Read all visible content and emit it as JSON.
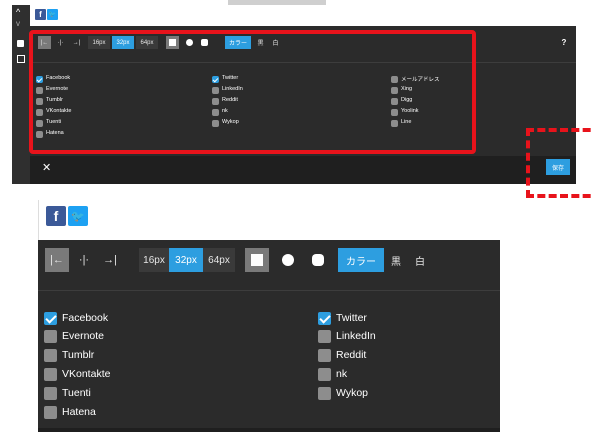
{
  "top": {
    "share_icons": [
      "f",
      "🐦"
    ],
    "toolbar": {
      "align_left": "|←",
      "align_center": "·|·",
      "align_right": "→|",
      "size_16": "16px",
      "size_32": "32px",
      "size_64": "64px",
      "color_label": "カラー",
      "black_label": "黒",
      "white_label": "白",
      "help": "?"
    },
    "networks": [
      {
        "label": "Facebook",
        "checked": true
      },
      {
        "label": "Evernote",
        "checked": false
      },
      {
        "label": "Tumblr",
        "checked": false
      },
      {
        "label": "VKontakte",
        "checked": false
      },
      {
        "label": "Tuenti",
        "checked": false
      },
      {
        "label": "Hatena",
        "checked": false
      },
      {
        "label": "Twitter",
        "checked": true
      },
      {
        "label": "LinkedIn",
        "checked": false
      },
      {
        "label": "Reddit",
        "checked": false
      },
      {
        "label": "nk",
        "checked": false
      },
      {
        "label": "Wykop",
        "checked": false
      },
      {
        "label": "メールアドレス",
        "checked": false
      },
      {
        "label": "Xing",
        "checked": false
      },
      {
        "label": "Digg",
        "checked": false
      },
      {
        "label": "Yoolink",
        "checked": false
      },
      {
        "label": "Line",
        "checked": false
      }
    ],
    "close_label": "✕",
    "save_label": "保存"
  },
  "zoom": {
    "share_icons": [
      "f",
      "🐦"
    ],
    "toolbar": {
      "align_left": "|←",
      "align_center": "·|·",
      "align_right": "→|",
      "size_16": "16px",
      "size_32": "32px",
      "size_64": "64px",
      "color_label": "カラー",
      "black_label": "黒",
      "white_label": "白"
    },
    "networks": [
      {
        "label": "Facebook",
        "checked": true
      },
      {
        "label": "Evernote",
        "checked": false
      },
      {
        "label": "Tumblr",
        "checked": false
      },
      {
        "label": "VKontakte",
        "checked": false
      },
      {
        "label": "Tuenti",
        "checked": false
      },
      {
        "label": "Hatena",
        "checked": false
      },
      {
        "label": "Twitter",
        "checked": true
      },
      {
        "label": "LinkedIn",
        "checked": false
      },
      {
        "label": "Reddit",
        "checked": false
      },
      {
        "label": "nk",
        "checked": false
      },
      {
        "label": "Wykop",
        "checked": false
      }
    ]
  },
  "colors": {
    "highlight_red": "#e8131b",
    "accent_blue": "#2d9ee0",
    "facebook_blue": "#3b5998",
    "twitter_blue": "#1da1f2"
  }
}
